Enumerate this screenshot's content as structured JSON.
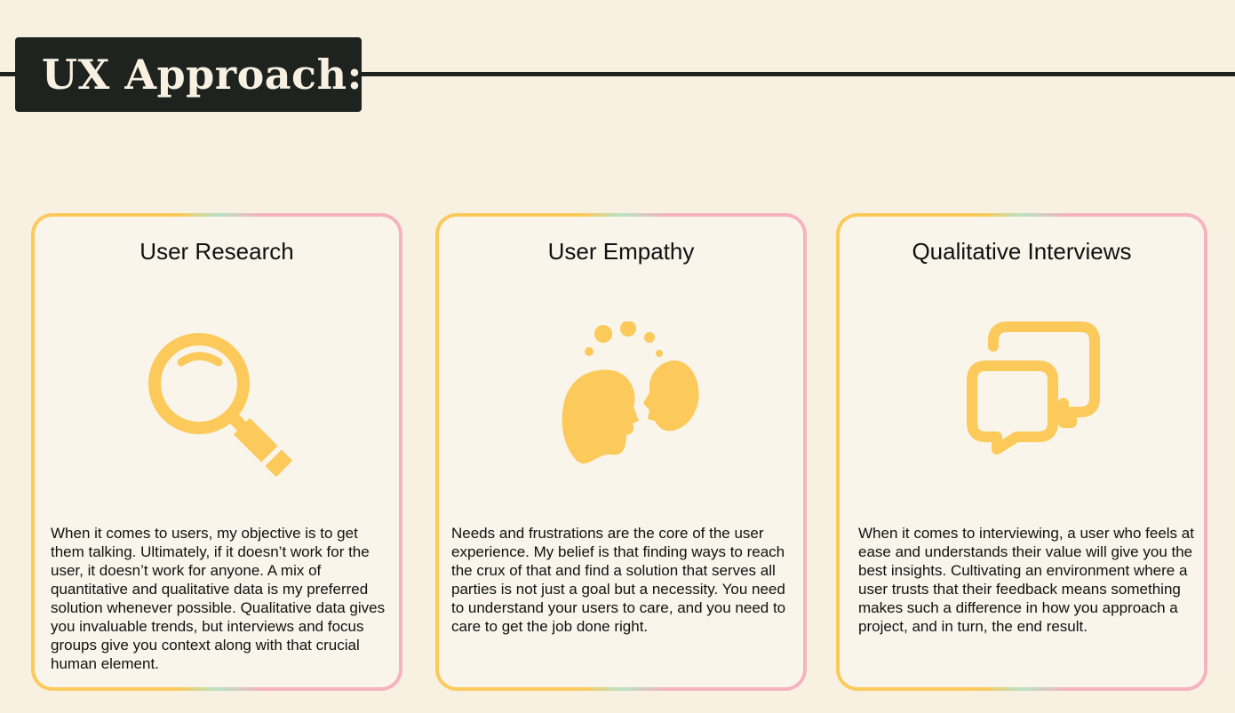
{
  "header": {
    "title": "UX Approach:"
  },
  "colors": {
    "background": "#f8f1e2",
    "dark": "#1e2320",
    "accent_yellow": "#fcc95b",
    "accent_pink": "#f5b3c1",
    "accent_green": "#b8e3c5"
  },
  "cards": [
    {
      "title": "User Research",
      "icon": "magnifying-glass-icon",
      "body": "When it comes to users, my objective is to get them talking. Ultimately, if it doesn’t work for the user, it doesn’t work for anyone. A mix of quantitative and qualitative data is my preferred solution whenever possible. Qualitative data gives you invaluable trends, but interviews and focus groups give you context along with that crucial human element."
    },
    {
      "title": "User Empathy",
      "icon": "two-heads-empathy-icon",
      "body": "Needs and frustrations are the core of the user experience. My belief is that finding ways to reach the crux of that and find a solution that serves all parties is not just a goal but a necessity. You need to understand your users to care, and you need to care to get the job done right."
    },
    {
      "title": "Qualitative Interviews",
      "icon": "chat-bubbles-icon",
      "body": "When it comes to interviewing, a user who feels at ease and understands their value will give you the best insights. Cultivating an environment where a user trusts that their feedback means something makes such a difference in how you approach a project, and in turn, the end result."
    }
  ]
}
